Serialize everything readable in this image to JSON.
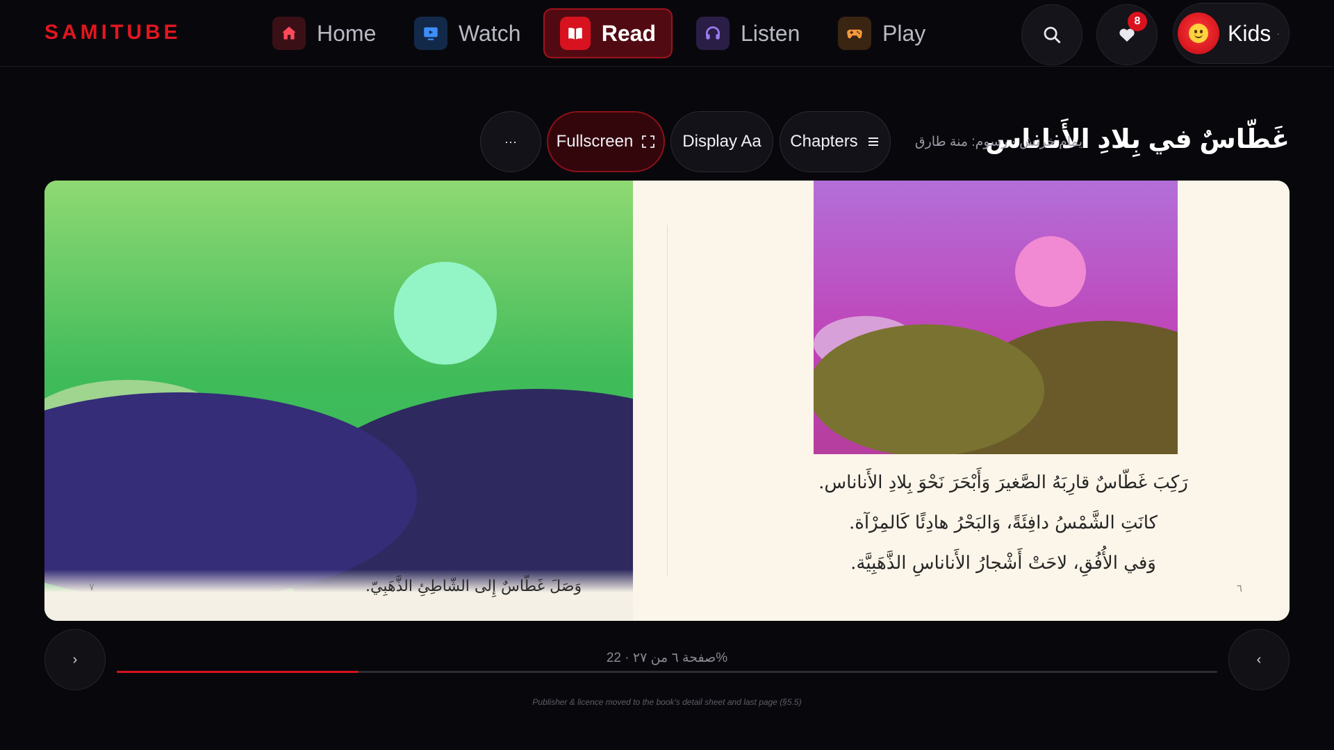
{
  "brand": "SAMITUBE",
  "nav": {
    "home": "Home",
    "watch": "Watch",
    "read": "Read",
    "listen": "Listen",
    "play": "Play"
  },
  "nav_icons": [
    "home-icon",
    "tv-icon",
    "book-icon",
    "headphones-icon",
    "gamepad-icon"
  ],
  "favorites_badge": "8",
  "profile": {
    "name": "Kids",
    "dot": "·"
  },
  "book": {
    "title": "غَطّاسٌ في بِلادِ الأَناناس",
    "meta": "يمام خرتش · رسوم: منة طارق"
  },
  "toolbar": {
    "more": "···",
    "fullscreen": "Fullscreen",
    "display": "Display Aa",
    "chapters": "Chapters"
  },
  "left_page": {
    "caption": "وَصَلَ غَطّاسٌ إِلى الشّاطِئِ الذَّهَبِيّ.",
    "number": "٧"
  },
  "right_page": {
    "lines": [
      "رَكِبَ غَطّاسٌ قارِبَهُ الصَّغيرَ وَأَبْحَرَ نَحْوَ بِلادِ الأَناناس.",
      "كانَتِ الشَّمْسُ دافِئَةً، وَالبَحْرُ هادِئًا كَالمِرْآة.",
      "وَفي الأُفُقِ، لاحَتْ أَشْجارُ الأَناناسِ الذَّهَبِيَّة."
    ],
    "number": "٦"
  },
  "progress": {
    "label": "صفحة ٦ من ٢٧ · 22%",
    "fraction": 0.22
  },
  "pager": {
    "next": "›",
    "prev": "‹"
  },
  "footnote": "Publisher & licence moved to the book's detail sheet and last page (§5.5)",
  "colors": {
    "accent": "#e3161f",
    "page_bg": "#08080c",
    "paper": "#fcf5e9"
  }
}
